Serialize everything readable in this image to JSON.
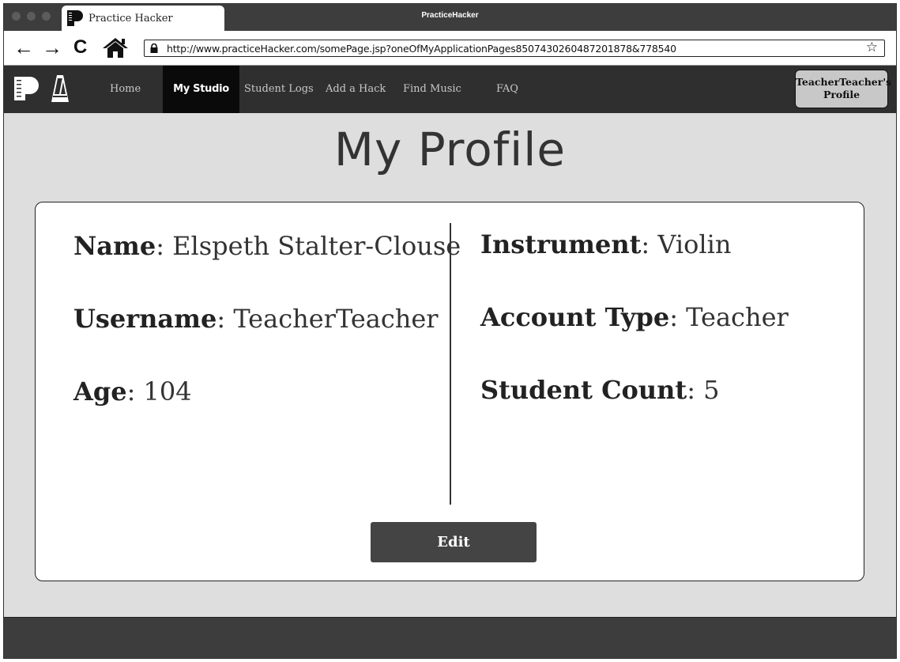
{
  "browser": {
    "tab_title": "Practice Hacker",
    "window_title": "PracticeHacker",
    "url": "http://www.practiceHacker.com/somePage.jsp?oneOfMyApplicationPages8507430260487201878&778540",
    "back_icon": "←",
    "forward_icon": "→",
    "reload_icon": "C",
    "star_icon": "☆"
  },
  "nav": {
    "items": [
      {
        "label": "Home"
      },
      {
        "label": "My Studio"
      },
      {
        "label": "Student Logs"
      },
      {
        "label": "Add a Hack"
      },
      {
        "label": "Find Music"
      },
      {
        "label": "FAQ"
      }
    ],
    "active": "My Studio",
    "profile_button": {
      "line1": "TeacherTeacher's",
      "line2": "Profile"
    }
  },
  "page": {
    "title": "My Profile",
    "left": [
      {
        "label": "Name",
        "value": "Elspeth Stalter-Clouse"
      },
      {
        "label": "Username",
        "value": "TeacherTeacher"
      },
      {
        "label": "Age",
        "value": "104"
      }
    ],
    "right": [
      {
        "label": "Instrument",
        "value": "Violin"
      },
      {
        "label": "Account Type",
        "value": "Teacher"
      },
      {
        "label": "Student Count",
        "value": "5"
      }
    ],
    "edit_label": "Edit"
  },
  "colors": {
    "page_bg": "#dedede",
    "navbar_bg": "#2f2f2f",
    "active_nav_bg": "#0a0a0a",
    "button_bg": "#444444"
  }
}
